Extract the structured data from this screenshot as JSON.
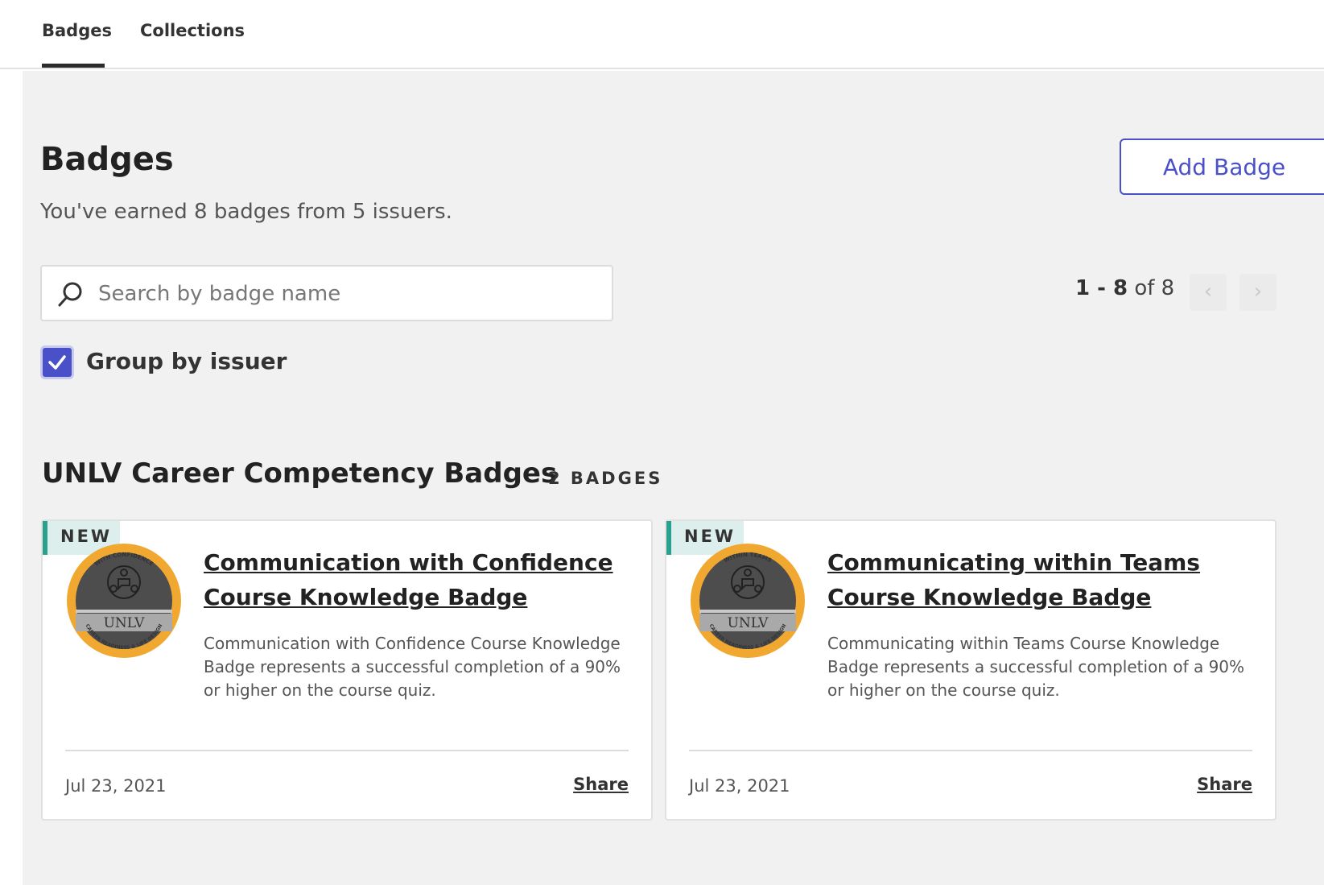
{
  "tabs": [
    {
      "label": "Badges",
      "active": true
    },
    {
      "label": "Collections",
      "active": false
    }
  ],
  "header": {
    "title": "Badges",
    "subtitle": "You've earned 8 badges from 5 issuers.",
    "add_button": "Add Badge"
  },
  "search": {
    "placeholder": "Search by badge name",
    "value": ""
  },
  "pagination": {
    "range": "1 - 8",
    "of_text": "of 8"
  },
  "group_toggle": {
    "label": "Group by issuer",
    "checked": true
  },
  "group": {
    "title": "UNLV Career Competency Badges",
    "count_label": "2 BADGES",
    "badges": [
      {
        "tag": "NEW",
        "title": "Communication with Confidence Course Knowledge Badge",
        "description": "Communication with Confidence Course Knowledge Badge represents a successful completion of a 90% or higher on the course quiz.",
        "date": "Jul 23, 2021",
        "share": "Share",
        "ring_text_top": "WITH CONFIDENCE",
        "ring_text_bottom": "CAREER READINESS & LIFE DESIGN",
        "seal_text": "UNLV"
      },
      {
        "tag": "NEW",
        "title": "Communicating within Teams Course Knowledge Badge",
        "description": "Communicating within Teams Course Knowledge Badge represents a successful completion of a 90% or higher on the course quiz.",
        "date": "Jul 23, 2021",
        "share": "Share",
        "ring_text_top": "WITHIN TEAMS",
        "ring_text_bottom": "CAREER READINESS & LIFE DESIGN",
        "seal_text": "UNLV"
      }
    ]
  },
  "colors": {
    "accent": "#4a50c7",
    "new_tag_bg": "#dcefec",
    "new_tag_border": "#2aa08f",
    "badge_ring": "#f0a830",
    "page_bg": "#f1f1f1"
  },
  "icons": {
    "search": "search-icon",
    "prev": "chevron-left-icon",
    "next": "chevron-right-icon",
    "check": "check-icon"
  }
}
